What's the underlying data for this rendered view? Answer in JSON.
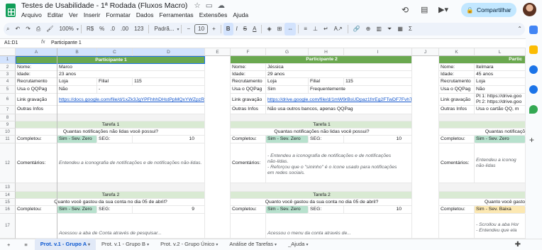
{
  "title": "Testes de Usabilidade - 1ª Rodada (Fluxos Macro)",
  "menu": [
    "Arquivo",
    "Editar",
    "Ver",
    "Inserir",
    "Formatar",
    "Dados",
    "Ferramentas",
    "Extensões",
    "Ajuda"
  ],
  "share_label": "Compartilhar",
  "toolbar": {
    "zoom": "100%",
    "currency": "R$",
    "percent": "%",
    "dec_less": ".0",
    "dec_more": ".00",
    "format123": "123",
    "font": "Padrã...",
    "font_size": "10",
    "bold": "B",
    "italic": "I",
    "strike": "S",
    "text_color": "A"
  },
  "formula": {
    "namebox": "A1:D1",
    "fx": "fx",
    "value": "Participante 1"
  },
  "columns": [
    "A",
    "B",
    "C",
    "D",
    "E",
    "F",
    "G",
    "H",
    "I",
    "J",
    "K",
    "L"
  ],
  "rows": [
    "1",
    "2",
    "3",
    "4",
    "5",
    "6",
    "7",
    "8",
    "9",
    "10",
    "11",
    "12",
    "13",
    "14",
    "15",
    "16",
    "17"
  ],
  "labels": {
    "nome": "Nome:",
    "idade": "Idade:",
    "recrutamento": "Recrutamento",
    "filial": "Filial",
    "usa": "Usa o QQPag",
    "link": "Link gravação",
    "outras": "Outras Infos",
    "completou": "Completou:",
    "comentarios": "Comentários:",
    "seg": "SEG:"
  },
  "p1": {
    "header": "Participante 1",
    "nome": "Marco",
    "idade": "23 anos",
    "recrut": "Loja",
    "filial_val": "115",
    "usa": "Não",
    "usa_extra": "-",
    "link": "https://docs.google.com/file/d/1xZk3JgYPFhhhDHstPpMQxYWZpzRI",
    "t1_status": "Sim - Sev. Zero",
    "t1_seg": "10",
    "t1_comment": "Entendeu a iconografia de notificações e de notificações não-lidas.",
    "t2_status": "Sim - Sev. Zero",
    "t2_seg": "9",
    "t2_comment": "Acessou a aba de Conta através de pesquisar..."
  },
  "p2": {
    "header": "Participante 2",
    "nome": "Jéssica",
    "idade": "29 anos",
    "recrut": "Loja",
    "filial_val": "115",
    "usa": "Sim",
    "usa_extra": "Frequentemente",
    "link": "https://drive.google.com/file/d/1mW9rBsUDpaz1frrEg2FTwDF7FvhT",
    "outras": "Não usa outros bancos, apenas QQPag",
    "t1_status": "Sim - Sev. Zero",
    "t1_seg": "10",
    "t1_comment": "- Entendeu a iconografia de notificações e de notificações não-lidas.\n- Reforçou que o \"sininho\" é o ícone usado para notificações em redes sociais.",
    "t2_status": "Sim - Sev. Zero",
    "t2_seg": "10",
    "t2_comment": "Acessou o menu da conta através de..."
  },
  "p3": {
    "header": "Partic",
    "nome": "Itelmara",
    "idade": "45 anos",
    "recrut": "Loja",
    "usa": "Não",
    "link": "Pt 1: https://drive.goo\nPt 2: https://drive.goo",
    "outras": "Usa o cartão QQ, m",
    "t1_status": "Sim - Sev. Zero",
    "t1_comment": "Entendeu a iconog não-lidas",
    "t2_status": "Sim - Sev. Baixa",
    "t2_comment": "- Scrollou a aba Hor\n- Entendeu que ela"
  },
  "tasks": {
    "t1": "Tarefa 1",
    "t1_q": "Quantas notificações não lidas você possui?",
    "t1_q_short": "Quantas notificaçõ",
    "t2": "Tarefa 2",
    "t2_q": "Quanto você gastou da sua conta no dia 05 de abril?",
    "t2_q_short": "Quanto você gasto"
  },
  "sheets": [
    "Prot. v.1 - Grupo A",
    "Prot. v.1 - Grupo B",
    "Prot. v.2 - Grupo Único",
    "Análise de Tarefas",
    "_Ajuda"
  ],
  "colors": {
    "accent": "#0b57d0",
    "header_green": "#6aa84f",
    "band_green": "#d9ead3",
    "chip_green": "#b7e1cd",
    "chip_yellow": "#fce8b2"
  }
}
